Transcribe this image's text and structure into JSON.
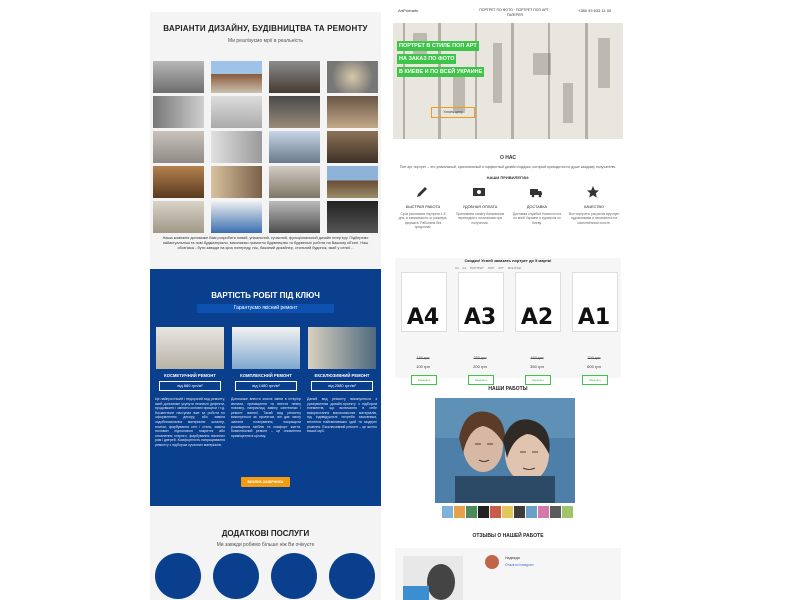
{
  "left_page": {
    "title": "ВАРІАНТИ ДИЗАЙНУ, БУДІВНИЦТВА ТА РЕМОНТУ",
    "subtitle": "Ми реалізуємо мрії в реальність",
    "gallery_description": "Наша компанія допоможе Вам розробити новий, унікальний, сучасний, функціональний дизайн інтер'єру. Підберемо найактуальніші та нові будматеріали, виконаємо грамотно будівництво та будівельні роботи на Вашому об'єкті. Наш обов'язок - бути завжди на крок попереду, ніж, бажаний дизайнер, стильний будинок, який у сенсі!...",
    "pricing": {
      "title": "ВАРТІСТЬ РОБІТ ПІД КЛЮЧ",
      "subtitle": "Гарантуємо якісний ремонт",
      "cards": [
        {
          "name": "КОСМЕТИЧНИЙ РЕМОНТ",
          "price": "від 880 грн/м²",
          "text": "Це найпростіший і недорогий вид ремонту, який допоможе усунути незначні дефекти, продовжити і змінити основні процеси і т.д. Косметичне наступає вже за роботи по оформленню декору, або заміна оздоблювальних матеріалів: шпалер, плитки, фарбування стін і стель, заміна половин підлогового покриття або оновлення старого, фарбування віконних рам і дверей. Комфортність напрацювання ремонту з підбором сучасних матеріалів."
        },
        {
          "name": "КОМПЛЕКСНИЙ РЕМОНТ",
          "price": "від 1480 грн/м²",
          "text": "Допоможе внести значні зміни в інтер'єр кімнати, приміщення та внести певну новизну, наприклад заміну сантехніки і ремонт ванної. Такий вид ремонту виконується за проектом, він дає змогу змінити планування, покращити розміщення меблів та комфорт життя. Комплексний ремонт – це оновлення приміщення в цілому."
        },
        {
          "name": "ЕКСКЛЮЗИВНИЙ РЕМОНТ",
          "price": "від 2580 грн/м²",
          "text": "Даний вид ремонту виконуються з урахуванням дизайн-проекту з підбором елементів, що включають в себе використання високоякісних матеріалів, під індивідуальні потреби замовника, втілення найсміливіших ідей та модерні рішення. Ексклюзивний ремонт – це житло вашої мрії."
        }
      ],
      "button": "ВИКЛИК ЗАМІРНИКА"
    },
    "services": {
      "title": "ДОДАТКОВІ ПОСЛУГИ",
      "subtitle": "Ми завжди робимо більше ніж Ви очікуєте"
    }
  },
  "right_page": {
    "header": {
      "logo": "ArtPortraits",
      "nav": "ПОРТРЕТ ПО ФОТО · ПОРТРЕТ ПОП АРТ · ГАЛЕРЕЯ",
      "phone": "+380 93 633 11 00"
    },
    "hero": {
      "lines": [
        "ПОРТРЕТ В СТИЛЕ ПОП АРТ",
        "НА ЗАКАЗ ПО ФОТО",
        "В КИЕВЕ И ПО ВСЕЙ УКРАИНЕ"
      ],
      "button": "Узнать цену"
    },
    "about": {
      "title": "О НАС",
      "text": "Поп арт портрет – это уникальный, оригинальный и эффектный дизайн подарка, который приходится по душе каждому получателю.",
      "privileges_title": "НАШИ ПРИВИЛЕГИИ:",
      "features": [
        {
          "icon": "pencil-icon",
          "title": "БЫСТРАЯ РАБОТА",
          "text": "Срок рисования портрета 1-5 дня, в зависимости от размера, формата. Работаем без предоплат."
        },
        {
          "icon": "money-icon",
          "title": "УДОБНАЯ ОПЛАТА",
          "text": "Принимаем оплату банковским переводом и наличными при получении."
        },
        {
          "icon": "truck-icon",
          "title": "ДОСТАВКА",
          "text": "Доставка службой Новая почта по всей Украине и курьером по Киеву."
        },
        {
          "icon": "star-icon",
          "title": "КАЧЕСТВО",
          "text": "Все портреты рисуются вручную художниками и печатаются на качественном холсте."
        }
      ]
    },
    "formats": {
      "title": "Скидки! Успей заказать портрет до 5 марта!",
      "tabs": "A4   A3   ПОРТРЕТ   ПОП АРТ   МОНТАЖ",
      "items": [
        {
          "size": "A4",
          "old_price": "150 грн",
          "new_price": "100 грн",
          "button": "Заказать"
        },
        {
          "size": "A3",
          "old_price": "250 грн",
          "new_price": "200 грн",
          "button": "Заказать"
        },
        {
          "size": "A2",
          "old_price": "450 грн",
          "new_price": "350 грн",
          "button": "Заказать"
        },
        {
          "size": "A1",
          "old_price": "700 грн",
          "new_price": "600 грн",
          "button": "Заказать"
        }
      ]
    },
    "works": {
      "title": "НАШИ РАБОТЫ"
    },
    "reviews": {
      "title": "ОТЗЫВЫ О НАШЕЙ РАБОТЕ",
      "name": "Надежда",
      "link": "Отзыв из Instagram"
    }
  }
}
